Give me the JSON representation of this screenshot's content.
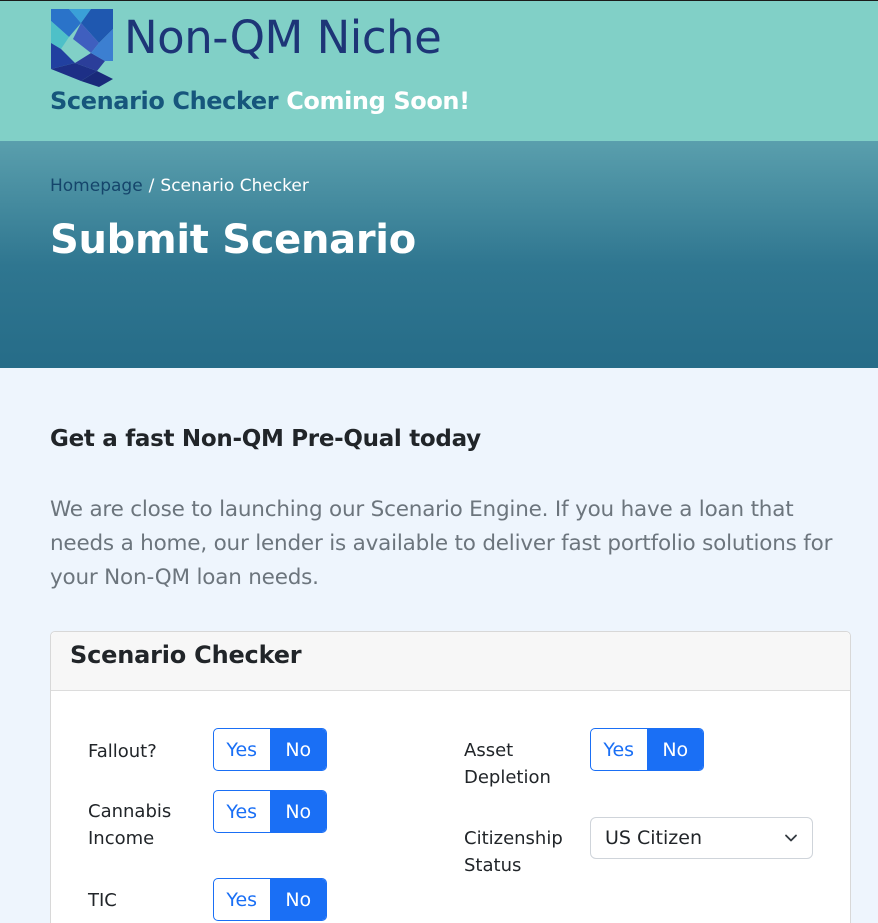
{
  "brand": {
    "name": "Non-QM Niche",
    "tagline_dark": "Scenario Checker",
    "tagline_light": "Coming Soon!"
  },
  "breadcrumb": {
    "home": "Homepage",
    "separator": "/",
    "current": "Scenario Checker"
  },
  "hero": {
    "title": "Submit Scenario"
  },
  "intro": {
    "title": "Get a fast Non-QM Pre-Qual today",
    "text": "We are close to launching our Scenario Engine. If you have a loan that needs a home, our lender is available to deliver fast portfolio solutions for your Non-QM loan needs."
  },
  "card": {
    "title": "Scenario Checker",
    "fields": {
      "fallout": {
        "label": "Fallout?",
        "yes": "Yes",
        "no": "No",
        "selected": "No"
      },
      "cannabis": {
        "label_line1": "Cannabis",
        "label_line2": "Income",
        "yes": "Yes",
        "no": "No",
        "selected": "No"
      },
      "tic": {
        "label": "TIC",
        "yes": "Yes",
        "no": "No",
        "selected": "No"
      },
      "asset_depletion": {
        "label_line1": "Asset",
        "label_line2": "Depletion",
        "yes": "Yes",
        "no": "No",
        "selected": "No"
      },
      "citizenship": {
        "label_line1": "Citizenship",
        "label_line2": "Status",
        "value": "US Citizen"
      }
    }
  },
  "colors": {
    "topbar": "#81d0c7",
    "brand_navy": "#1d3577",
    "accent_blue": "#1a6ff5",
    "page_bg": "#eef5fd"
  }
}
